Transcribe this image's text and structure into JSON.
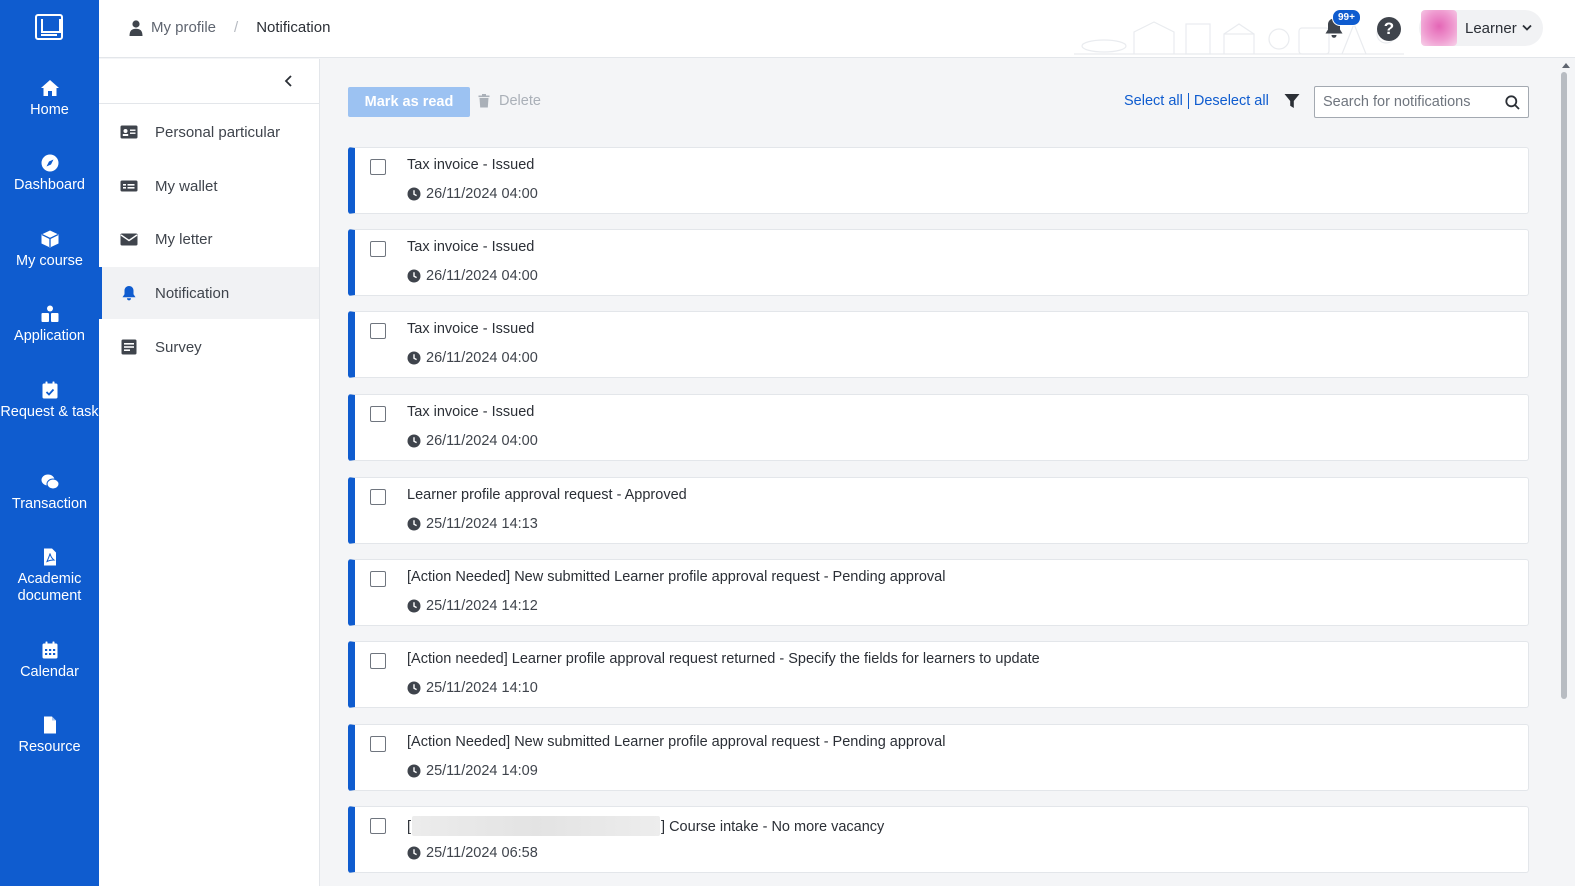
{
  "nav": {
    "logo_icon": "institution-logo-icon",
    "items": [
      {
        "label": "Home",
        "icon": "home-icon"
      },
      {
        "label": "Dashboard",
        "icon": "compass-icon"
      },
      {
        "label": "My course",
        "icon": "cube-icon"
      },
      {
        "label": "Application",
        "icon": "application-icon"
      },
      {
        "label": "Request & task",
        "icon": "calendar-check-icon"
      },
      {
        "label": "Transaction",
        "icon": "coins-icon"
      },
      {
        "label": "Academic document",
        "icon": "pdf-file-icon"
      },
      {
        "label": "Calendar",
        "icon": "calendar-icon"
      },
      {
        "label": "Resource",
        "icon": "file-icon"
      }
    ]
  },
  "header": {
    "breadcrumb": {
      "parent": "My profile",
      "separator": "/",
      "current": "Notification"
    },
    "notification_badge": "99+",
    "help_label": "?",
    "user_name": "Learner"
  },
  "profile_menu": {
    "items": [
      {
        "label": "Personal particular",
        "icon": "id-card-icon",
        "active": false
      },
      {
        "label": "My wallet",
        "icon": "wallet-card-icon",
        "active": false
      },
      {
        "label": "My letter",
        "icon": "envelope-icon",
        "active": false
      },
      {
        "label": "Notification",
        "icon": "bell-icon",
        "active": true
      },
      {
        "label": "Survey",
        "icon": "survey-icon",
        "active": false
      }
    ]
  },
  "toolbar": {
    "mark_as_read": "Mark as read",
    "delete": "Delete",
    "select_all": "Select all",
    "deselect_all": "Deselect all",
    "search_placeholder": "Search for notifications",
    "search_value": ""
  },
  "notifications": [
    {
      "title": "Tax invoice - Issued",
      "time": "26/11/2024 04:00"
    },
    {
      "title": "Tax invoice - Issued",
      "time": "26/11/2024 04:00"
    },
    {
      "title": "Tax invoice - Issued",
      "time": "26/11/2024 04:00"
    },
    {
      "title": "Tax invoice - Issued",
      "time": "26/11/2024 04:00"
    },
    {
      "title": "Learner profile approval request - Approved",
      "time": "25/11/2024 14:13"
    },
    {
      "title": "[Action Needed] New submitted Learner profile approval request - Pending approval",
      "time": "25/11/2024 14:12"
    },
    {
      "title": "[Action needed] Learner profile approval request returned - Specify the fields for learners to update",
      "time": "25/11/2024 14:10"
    },
    {
      "title": "[Action Needed] New submitted Learner profile approval request - Pending approval",
      "time": "25/11/2024 14:09"
    },
    {
      "title_prefix": "[",
      "title_suffix": "] Course intake - No more vacancy",
      "time": "25/11/2024 06:58"
    }
  ],
  "colors": {
    "primary": "#0f5ccf",
    "mark_button_disabled": "#9cc2f2",
    "active_menu_bg": "#f1f2f4",
    "page_bg": "#f4f5f7"
  }
}
